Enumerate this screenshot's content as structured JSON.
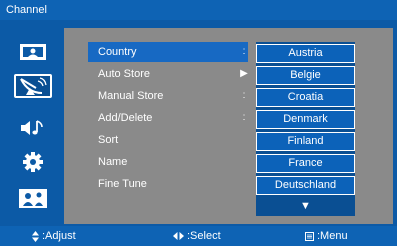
{
  "window": {
    "title": "Channel"
  },
  "sidebar": {
    "items": [
      {
        "icon": "picture-icon",
        "selected": false
      },
      {
        "icon": "satellite-dish-icon",
        "selected": true
      },
      {
        "icon": "sound-icon",
        "selected": false
      },
      {
        "icon": "settings-gear-icon",
        "selected": false
      },
      {
        "icon": "parental-lock-icon",
        "selected": false
      }
    ]
  },
  "menu": {
    "items": [
      {
        "label": "Country",
        "marker": ":"
      },
      {
        "label": "Auto Store",
        "marker": "▶"
      },
      {
        "label": "Manual Store",
        "marker": ":"
      },
      {
        "label": "Add/Delete",
        "marker": ":"
      },
      {
        "label": "Sort",
        "marker": ""
      },
      {
        "label": "Name",
        "marker": ""
      },
      {
        "label": "Fine Tune",
        "marker": ""
      }
    ]
  },
  "country_list": {
    "options": [
      "Austria",
      "Belgie",
      "Croatia",
      "Denmark",
      "Finland",
      "France",
      "Deutschland"
    ],
    "more_indicator": "▼"
  },
  "status_bar": {
    "adjust": ":Adjust",
    "select": ":Select",
    "menu": ":Menu"
  },
  "colors": {
    "background": "#0c5aa6",
    "panel": "#8a8a8a",
    "highlight": "#1769c3",
    "list_item": "#0c62b9",
    "text": "#ffffff"
  }
}
